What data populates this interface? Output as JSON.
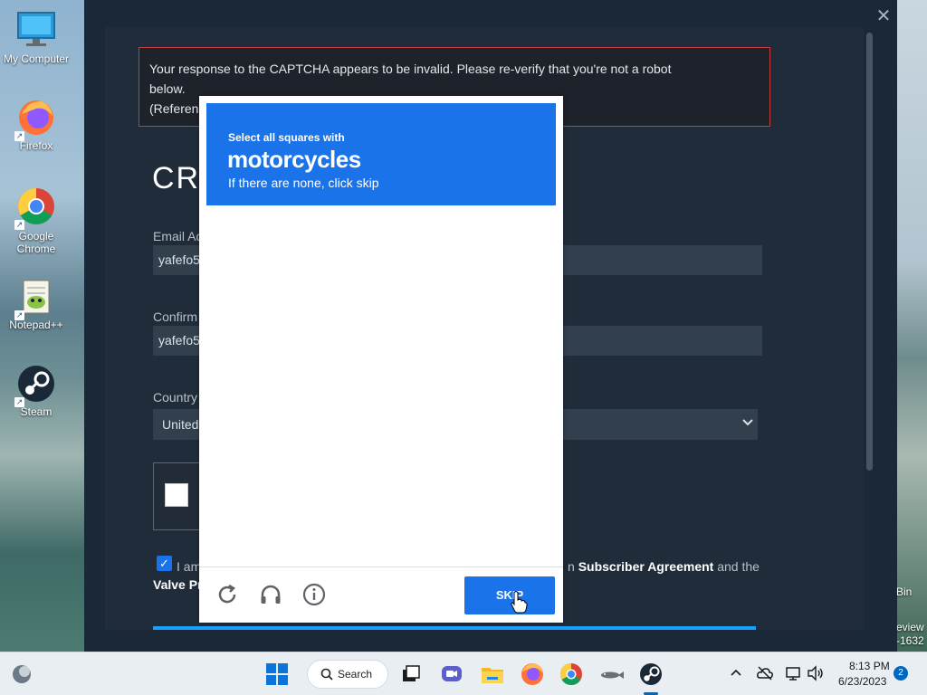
{
  "desktop": {
    "icons": [
      {
        "label": "My Computer"
      },
      {
        "label": "Firefox"
      },
      {
        "label": "Google Chrome"
      },
      {
        "label": "Notepad++"
      },
      {
        "label": "Steam"
      }
    ],
    "right_partial": {
      "bin": "Bin",
      "preview": "eview",
      "build": "-1632"
    }
  },
  "steam": {
    "close": "✕",
    "error_line1": "Your response to the CAPTCHA appears to be invalid. Please re-verify that you're not a robot",
    "error_line2": "below.",
    "error_line3": "(Referen",
    "create_title": "CR",
    "email_label": "Email Ad",
    "email_value": "yafefo5",
    "confirm_label": "Confirm",
    "confirm_value": "yafefo5",
    "country_label": "Country",
    "country_value": "United",
    "agree_text_start": "I am",
    "agree_subscriber": "Subscriber Agreement",
    "agree_and_the": "and the",
    "agree_valve": "Valve Pr",
    "partial_n": "n"
  },
  "captcha": {
    "instruction": "Select all squares with",
    "target": "motorcycles",
    "hint": "If there are none, click skip",
    "skip_label": "SKIP"
  },
  "taskbar": {
    "search_label": "Search",
    "time": "8:13 PM",
    "date": "6/23/2023",
    "notification_count": "2",
    "accent": "#0067c0"
  }
}
